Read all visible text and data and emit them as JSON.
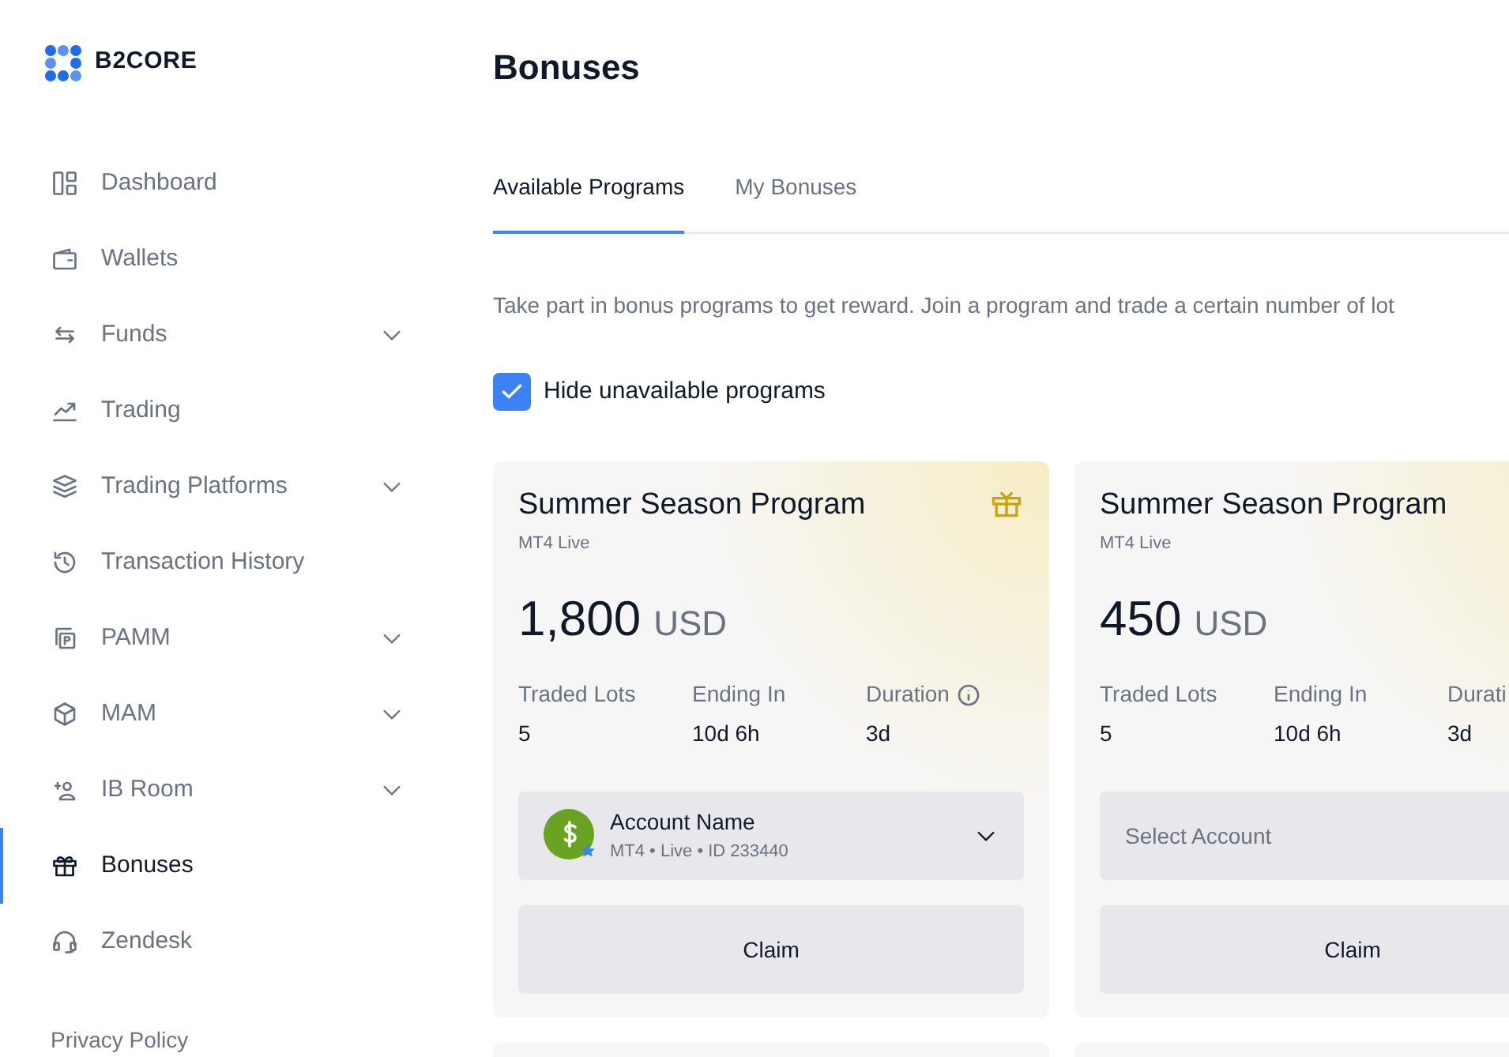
{
  "logo": {
    "text": "B2CORE"
  },
  "sidebar": {
    "items": [
      {
        "label": "Dashboard",
        "expandable": false,
        "selected": false
      },
      {
        "label": "Wallets",
        "expandable": false,
        "selected": false
      },
      {
        "label": "Funds",
        "expandable": true,
        "selected": false
      },
      {
        "label": "Trading",
        "expandable": false,
        "selected": false
      },
      {
        "label": "Trading Platforms",
        "expandable": true,
        "selected": false
      },
      {
        "label": "Transaction History",
        "expandable": false,
        "selected": false
      },
      {
        "label": "PAMM",
        "expandable": true,
        "selected": false
      },
      {
        "label": "MAM",
        "expandable": true,
        "selected": false
      },
      {
        "label": "IB Room",
        "expandable": true,
        "selected": false
      },
      {
        "label": "Bonuses",
        "expandable": false,
        "selected": true
      },
      {
        "label": "Zendesk",
        "expandable": false,
        "selected": false
      }
    ],
    "footer_link": "Privacy Policy"
  },
  "page_title": "Bonuses",
  "tabs": [
    {
      "label": "Available Programs",
      "selected": true
    },
    {
      "label": "My Bonuses",
      "selected": false
    }
  ],
  "description": "Take part in bonus programs to get reward. Join a program and trade a certain number of lot",
  "hide_unavailable": {
    "label": "Hide unavailable programs",
    "checked": true
  },
  "cards": [
    {
      "title": "Summer Season Program",
      "subtitle": "MT4 Live",
      "amount": "1,800",
      "currency": "USD",
      "gift_icon": true,
      "stats": [
        {
          "label": "Traded Lots",
          "value": "5",
          "info": false
        },
        {
          "label": "Ending In",
          "value": "10d 6h",
          "info": false
        },
        {
          "label": "Duration",
          "value": "3d",
          "info": true
        }
      ],
      "account": {
        "kind": "account",
        "name": "Account Name",
        "detail": "MT4 • Live • ID 233440"
      },
      "button": "Claim"
    },
    {
      "title": "Summer Season Program",
      "subtitle": "MT4 Live",
      "amount": "450",
      "currency": "USD",
      "gift_icon": false,
      "stats": [
        {
          "label": "Traded Lots",
          "value": "5",
          "info": false
        },
        {
          "label": "Ending In",
          "value": "10d 6h",
          "info": false
        },
        {
          "label": "Durati",
          "value": "3d",
          "info": false
        }
      ],
      "account": {
        "kind": "placeholder",
        "placeholder": "Select Account"
      },
      "button": "Claim"
    }
  ]
}
